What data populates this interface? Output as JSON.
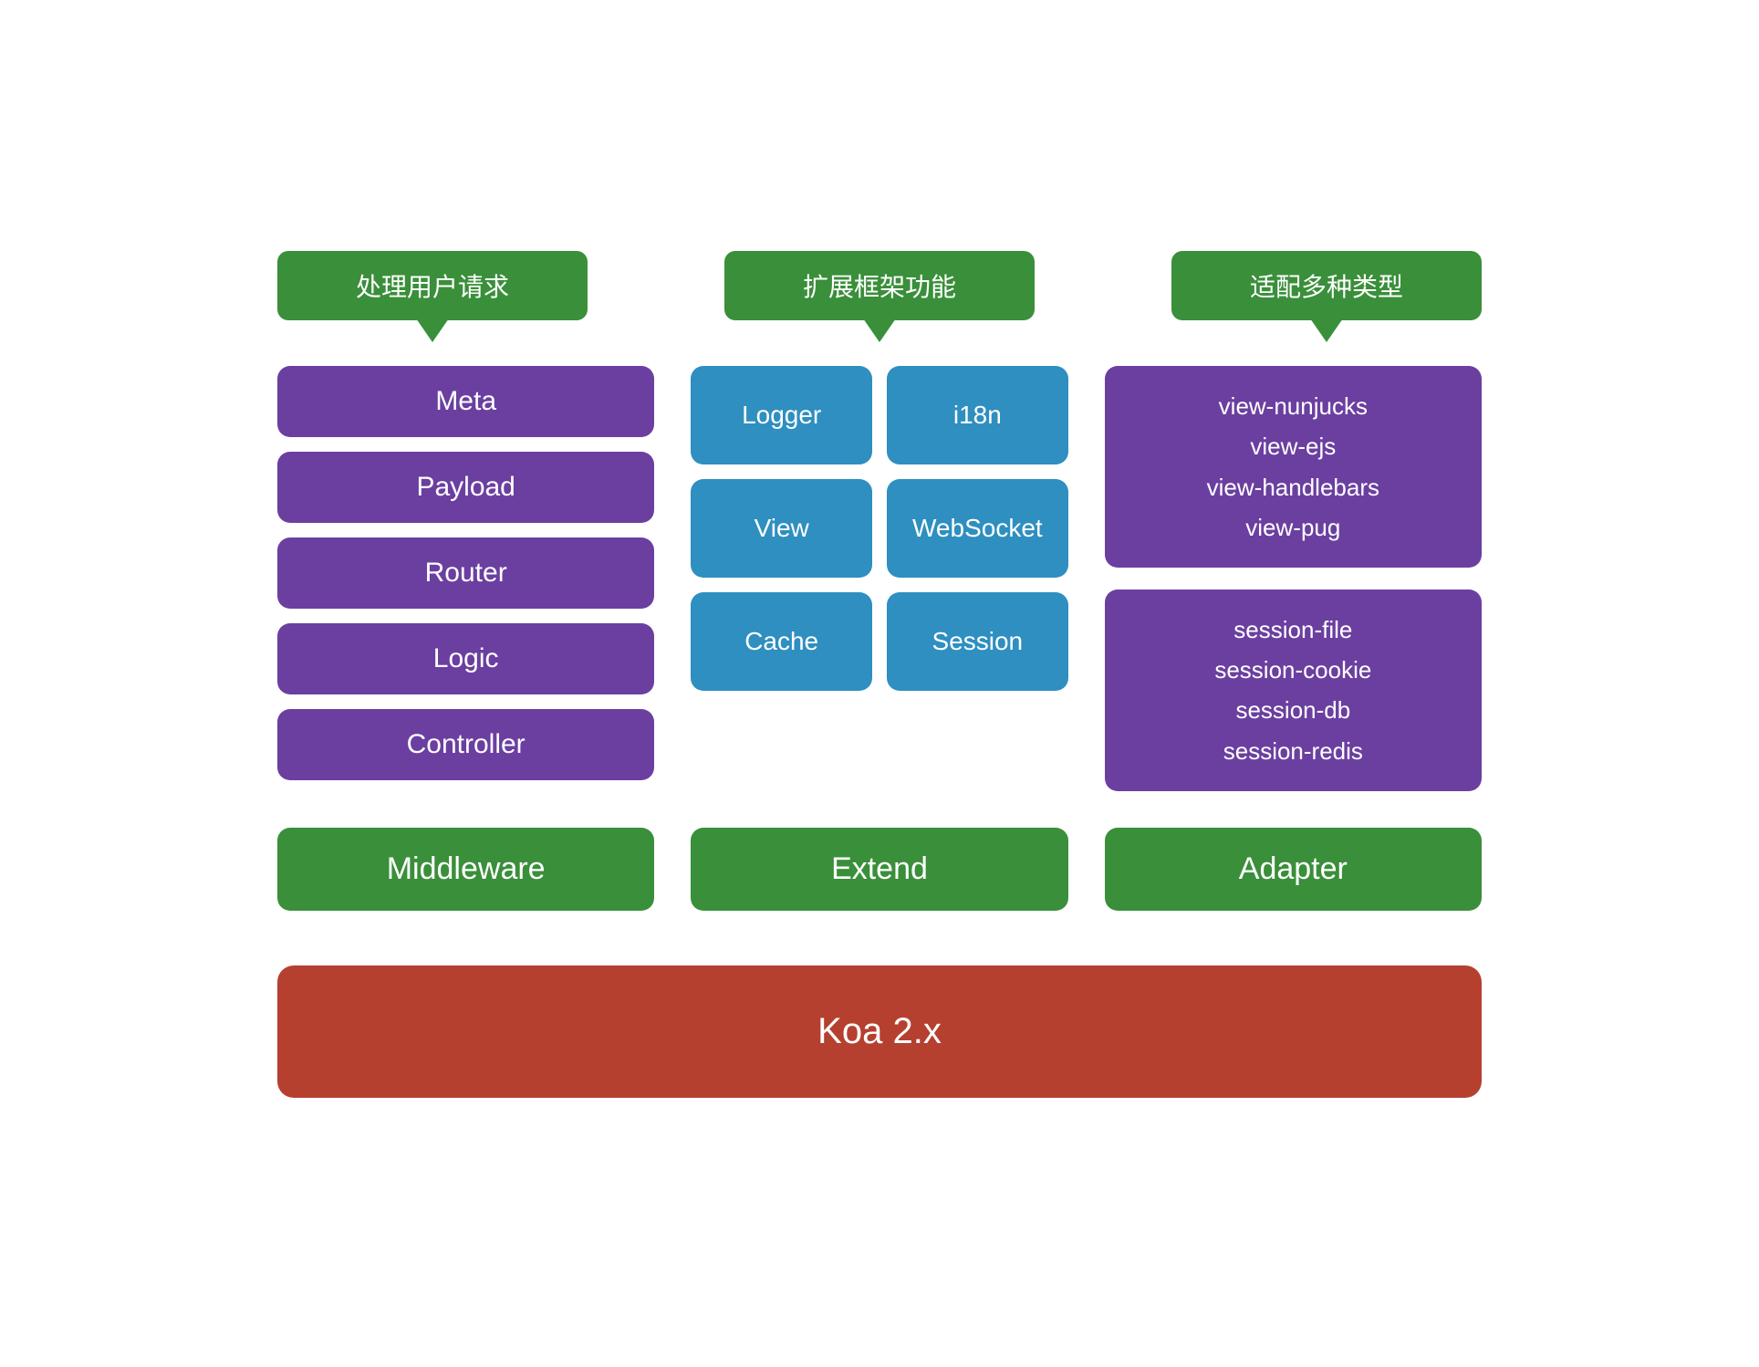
{
  "bubbles": [
    {
      "label": "处理用户请求"
    },
    {
      "label": "扩展框架功能"
    },
    {
      "label": "适配多种类型"
    }
  ],
  "middleware_items": [
    {
      "label": "Meta"
    },
    {
      "label": "Payload"
    },
    {
      "label": "Router"
    },
    {
      "label": "Logic"
    },
    {
      "label": "Controller"
    }
  ],
  "extend_rows": [
    [
      {
        "label": "Logger"
      },
      {
        "label": "i18n"
      }
    ],
    [
      {
        "label": "View"
      },
      {
        "label": "WebSocket"
      }
    ],
    [
      {
        "label": "Cache"
      },
      {
        "label": "Session"
      }
    ]
  ],
  "adapter_blocks": [
    {
      "label": "view-nunjucks\nview-ejs\nview-handlebars\nview-pug"
    },
    {
      "label": "session-file\nsession-cookie\nsession-db\nsession-redis"
    }
  ],
  "bottom_labels": [
    {
      "label": "Middleware"
    },
    {
      "label": "Extend"
    },
    {
      "label": "Adapter"
    }
  ],
  "koa_label": "Koa 2.x"
}
